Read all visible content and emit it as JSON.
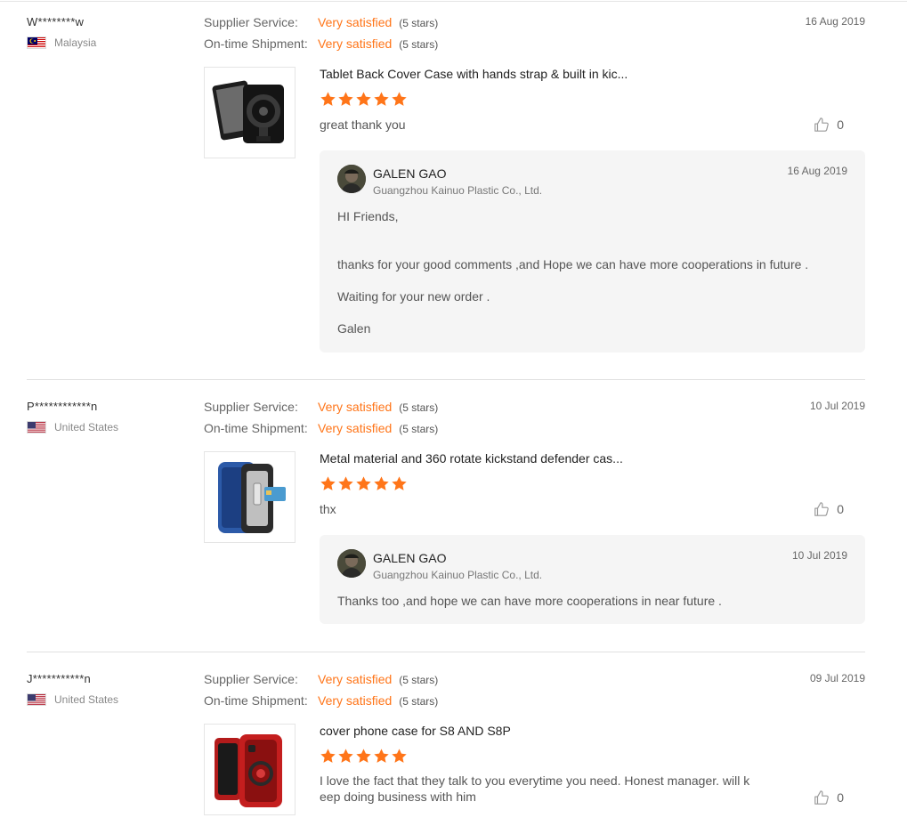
{
  "labels": {
    "supplier_service": "Supplier Service:",
    "on_time_shipment": "On-time Shipment:"
  },
  "colors": {
    "accent": "#ff7519",
    "divider": "#e0e0e0",
    "reply_bg": "#f5f5f5"
  },
  "reviews": [
    {
      "buyer": "W********w",
      "country": "Malaysia",
      "flag": "malaysia-flag",
      "date": "16 Aug 2019",
      "supplier_service": {
        "value": "Very satisfied",
        "stars": "(5 stars)"
      },
      "shipment": {
        "value": "Very satisfied",
        "stars": "(5 stars)"
      },
      "product_title": "Tablet Back Cover Case with hands strap & built in kic...",
      "rating": 5,
      "comment": "great thank you",
      "likes": "0",
      "reply": {
        "name": "GALEN GAO",
        "company": "Guangzhou Kainuo Plastic Co., Ltd.",
        "date": "16 Aug 2019",
        "paragraphs": [
          "HI Friends,",
          "thanks for your good comments ,and Hope we can have more cooperations in future .",
          "Waiting for your new order .",
          "Galen"
        ]
      }
    },
    {
      "buyer": "P************n",
      "country": "United States",
      "flag": "us-flag",
      "date": "10 Jul 2019",
      "supplier_service": {
        "value": "Very satisfied",
        "stars": "(5 stars)"
      },
      "shipment": {
        "value": "Very satisfied",
        "stars": "(5 stars)"
      },
      "product_title": "Metal material and 360 rotate kickstand defender cas...",
      "rating": 5,
      "comment": "thx",
      "likes": "0",
      "reply": {
        "name": "GALEN GAO",
        "company": "Guangzhou Kainuo Plastic Co., Ltd.",
        "date": "10 Jul 2019",
        "paragraphs": [
          "Thanks too ,and hope we can have more cooperations in near future ."
        ]
      }
    },
    {
      "buyer": "J***********n",
      "country": "United States",
      "flag": "us-flag",
      "date": "09 Jul 2019",
      "supplier_service": {
        "value": "Very satisfied",
        "stars": "(5 stars)"
      },
      "shipment": {
        "value": "Very satisfied",
        "stars": "(5 stars)"
      },
      "product_title": "cover phone case for S8 AND S8P",
      "rating": 5,
      "comment_lines": [
        "I love the fact that they talk to you everytime you need. Honest manager. will k",
        "eep doing business with him"
      ],
      "likes": "0"
    }
  ]
}
